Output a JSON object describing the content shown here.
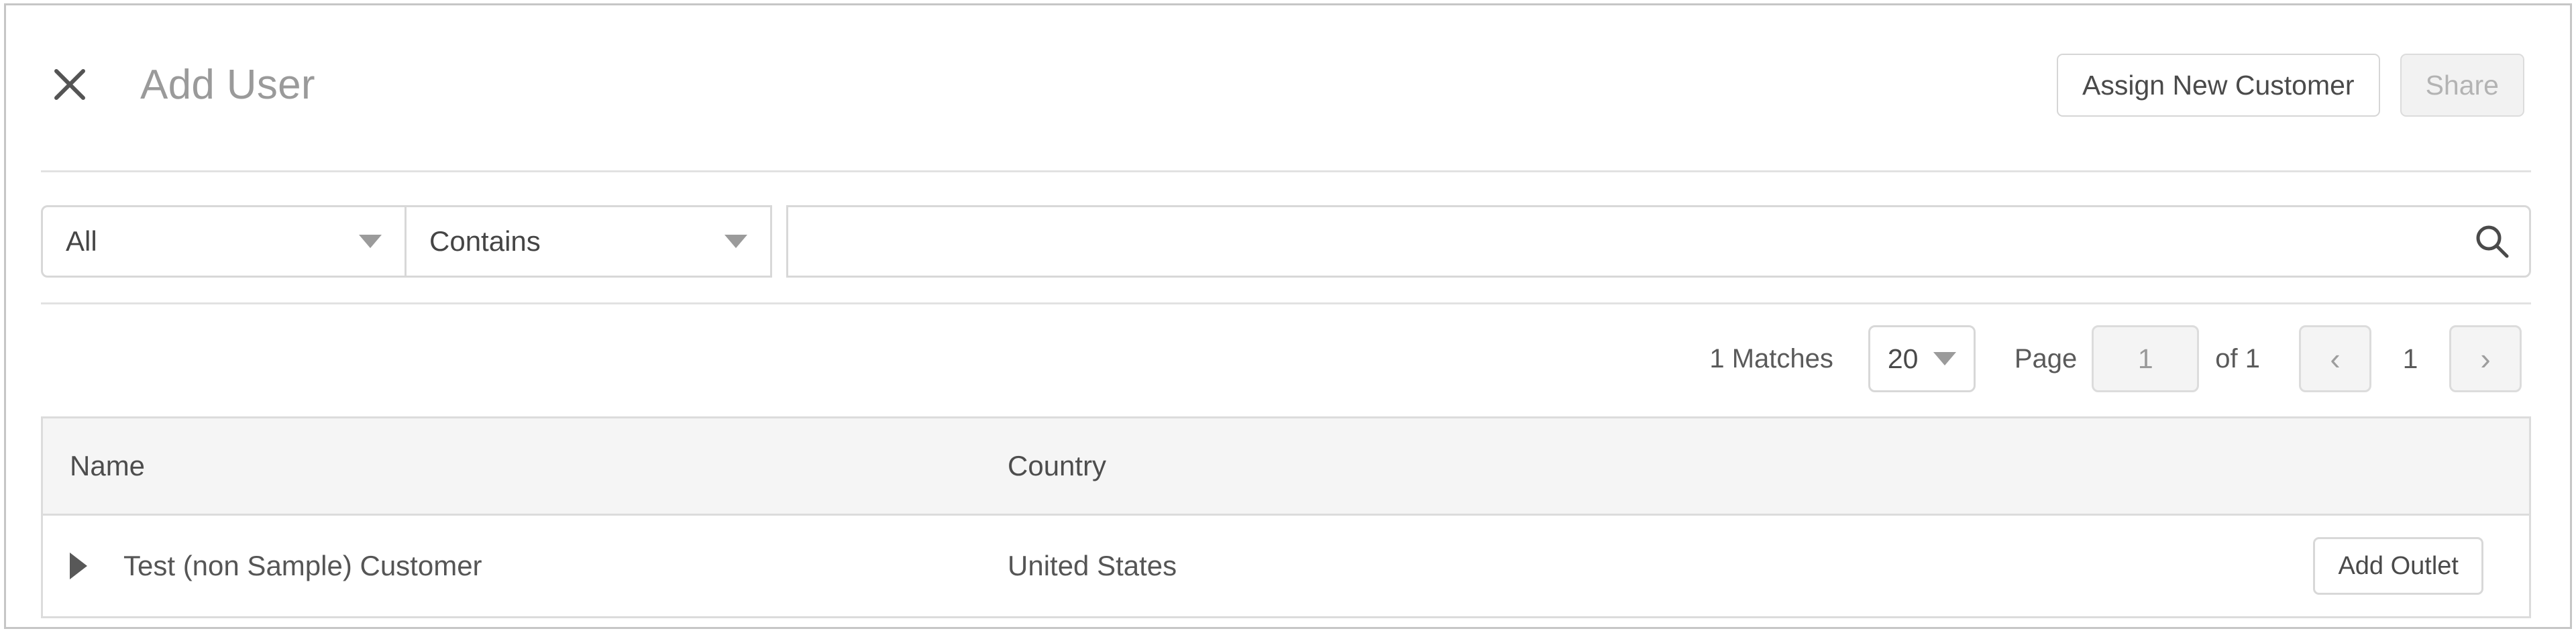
{
  "header": {
    "close_icon": "close-icon",
    "title": "Add User",
    "assign_button": "Assign New Customer",
    "share_button": "Share"
  },
  "filter": {
    "field_select": "All",
    "operator_select": "Contains",
    "search_value": "",
    "search_placeholder": "",
    "search_icon": "search-icon"
  },
  "pagination": {
    "matches": "1 Matches",
    "page_size": "20",
    "page_label": "Page",
    "page_value": "1",
    "of_label": "of 1",
    "prev_icon": "‹",
    "current_page": "1",
    "next_icon": "›"
  },
  "table": {
    "columns": [
      "Name",
      "Country",
      ""
    ],
    "rows": [
      {
        "name": "Test (non Sample) Customer",
        "country": "United States",
        "action": "Add Outlet"
      }
    ]
  },
  "colors": {
    "border": "#dcdcdc",
    "header_bg": "#f5f5f5",
    "title_text": "#9a9a9a",
    "body_text": "#4d4d4d",
    "disabled_text": "#b3b3b3"
  }
}
